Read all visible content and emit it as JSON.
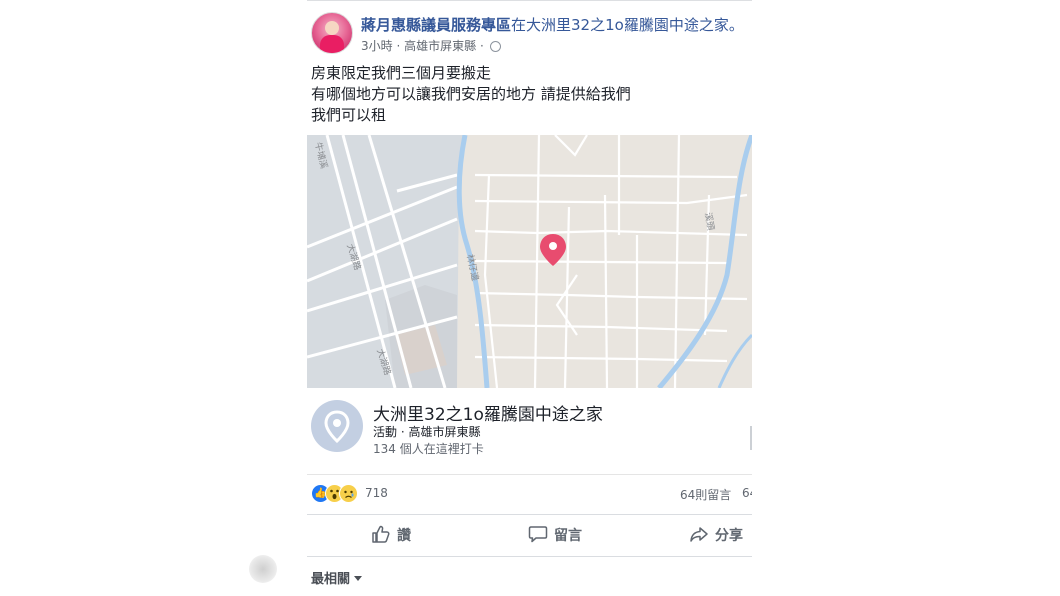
{
  "post": {
    "page_name": "蔣月惠縣議員服務專區",
    "location_text": "在大洲里32之1o羅騰園中途之家。",
    "time": "3小時",
    "location_meta": "高雄市屏東縣",
    "body_lines": [
      "房東限定我們三個月要搬走",
      "有哪個地方可以讓我們安居的地方 請提供給我們",
      "我們可以租"
    ]
  },
  "map": {
    "road_labels": [
      "大湖路",
      "大湖路",
      "林仔邊",
      "牛埔溪",
      "溪頭"
    ],
    "colors": {
      "land": "#e9e5df",
      "left_area": "#d6dbe0",
      "river": "#a9cdee",
      "pin": "#e84c6f"
    }
  },
  "place": {
    "name": "大洲里32之1o羅騰園中途之家",
    "category": "活動 · 高雄市屏東縣",
    "checkins": "134 個人在這裡打卡"
  },
  "reactions": {
    "count": "718",
    "comments": "64則留言",
    "comments_cut": "64",
    "icons": [
      "like-icon",
      "wow-icon",
      "sad-icon"
    ]
  },
  "actions": {
    "like": "讚",
    "comment": "留言",
    "share": "分享"
  },
  "sort": {
    "label": "最相關"
  }
}
